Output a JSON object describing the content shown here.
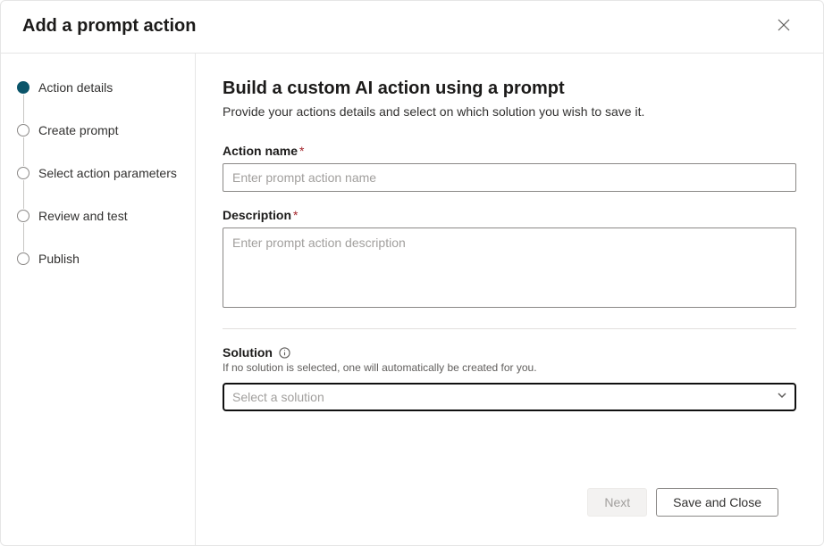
{
  "dialog": {
    "title": "Add a prompt action"
  },
  "steps": {
    "items": [
      {
        "label": "Action details"
      },
      {
        "label": "Create prompt"
      },
      {
        "label": "Select action parameters"
      },
      {
        "label": "Review and test"
      },
      {
        "label": "Publish"
      }
    ]
  },
  "page": {
    "title": "Build a custom AI action using a prompt",
    "subtitle": "Provide your actions details and select on which solution you wish to save it."
  },
  "form": {
    "actionName": {
      "label": "Action name",
      "placeholder": "Enter prompt action name",
      "value": ""
    },
    "description": {
      "label": "Description",
      "placeholder": "Enter prompt action description",
      "value": ""
    },
    "solution": {
      "label": "Solution",
      "helper": "If no solution is selected, one will automatically be created for you.",
      "placeholder": "Select a solution",
      "value": ""
    },
    "requiredMark": "*"
  },
  "footer": {
    "next": "Next",
    "saveClose": "Save and Close"
  }
}
